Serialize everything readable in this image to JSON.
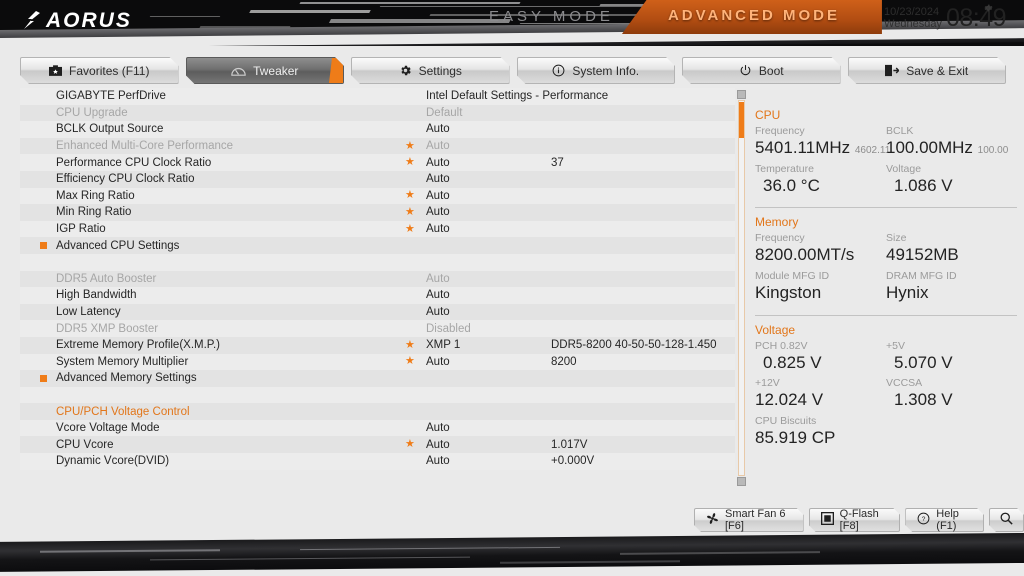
{
  "brand": {
    "logo_text": "AORUS"
  },
  "header": {
    "easy_mode": "EASY MODE",
    "advanced_mode": "ADVANCED MODE",
    "date": "10/23/2024",
    "weekday": "Wednesday",
    "time": "08:49",
    "gear_icon": "gear-icon"
  },
  "tabs": [
    {
      "label": "Favorites (F11)",
      "icon": "star-box-icon",
      "active": false
    },
    {
      "label": "Tweaker",
      "icon": "gauge-icon",
      "active": true
    },
    {
      "label": "Settings",
      "icon": "gear-icon",
      "active": false
    },
    {
      "label": "System Info.",
      "icon": "info-icon",
      "active": false
    },
    {
      "label": "Boot",
      "icon": "power-icon",
      "active": false
    },
    {
      "label": "Save & Exit",
      "icon": "exit-icon",
      "active": false
    }
  ],
  "settings_rows": [
    {
      "label": "GIGABYTE PerfDrive",
      "value": "Intel Default Settings - Performance",
      "extra": "",
      "star": false,
      "dim": false,
      "bullet": false
    },
    {
      "label": "CPU Upgrade",
      "value": "Default",
      "extra": "",
      "star": false,
      "dim": true,
      "bullet": false
    },
    {
      "label": "BCLK Output Source",
      "value": "Auto",
      "extra": "",
      "star": false,
      "dim": false,
      "bullet": false
    },
    {
      "label": "Enhanced Multi-Core Performance",
      "value": "Auto",
      "extra": "",
      "star": true,
      "dim": true,
      "bullet": false
    },
    {
      "label": "Performance CPU Clock Ratio",
      "value": "Auto",
      "extra": "37",
      "star": true,
      "dim": false,
      "bullet": false
    },
    {
      "label": "Efficiency CPU Clock Ratio",
      "value": "Auto",
      "extra": "",
      "star": false,
      "dim": false,
      "bullet": false
    },
    {
      "label": "Max Ring Ratio",
      "value": "Auto",
      "extra": "",
      "star": true,
      "dim": false,
      "bullet": false
    },
    {
      "label": "Min Ring Ratio",
      "value": "Auto",
      "extra": "",
      "star": true,
      "dim": false,
      "bullet": false
    },
    {
      "label": "IGP Ratio",
      "value": "Auto",
      "extra": "",
      "star": true,
      "dim": false,
      "bullet": false
    },
    {
      "label": "Advanced CPU Settings",
      "value": "",
      "extra": "",
      "star": false,
      "dim": false,
      "bullet": true
    },
    {
      "label": "",
      "value": "",
      "extra": "",
      "star": false,
      "dim": false,
      "bullet": false
    },
    {
      "label": "DDR5 Auto Booster",
      "value": "Auto",
      "extra": "",
      "star": false,
      "dim": true,
      "bullet": false
    },
    {
      "label": "High Bandwidth",
      "value": "Auto",
      "extra": "",
      "star": false,
      "dim": false,
      "bullet": false
    },
    {
      "label": "Low Latency",
      "value": "Auto",
      "extra": "",
      "star": false,
      "dim": false,
      "bullet": false
    },
    {
      "label": "DDR5 XMP Booster",
      "value": "Disabled",
      "extra": "",
      "star": false,
      "dim": true,
      "bullet": false
    },
    {
      "label": "Extreme Memory Profile(X.M.P.)",
      "value": "XMP 1",
      "extra": "DDR5-8200 40-50-50-128-1.450",
      "star": true,
      "dim": false,
      "bullet": false
    },
    {
      "label": "System Memory Multiplier",
      "value": "Auto",
      "extra": "8200",
      "star": true,
      "dim": false,
      "bullet": false
    },
    {
      "label": "Advanced Memory Settings",
      "value": "",
      "extra": "",
      "star": false,
      "dim": false,
      "bullet": true
    },
    {
      "label": "",
      "value": "",
      "extra": "",
      "star": false,
      "dim": false,
      "bullet": false
    },
    {
      "label": "CPU/PCH Voltage Control",
      "value": "",
      "extra": "",
      "star": false,
      "dim": false,
      "bullet": false,
      "section": true
    },
    {
      "label": "Vcore Voltage Mode",
      "value": "Auto",
      "extra": "",
      "star": false,
      "dim": false,
      "bullet": false
    },
    {
      "label": "CPU Vcore",
      "value": "Auto",
      "extra": "1.017V",
      "star": true,
      "dim": false,
      "bullet": false
    },
    {
      "label": "Dynamic Vcore(DVID)",
      "value": "Auto",
      "extra": "+0.000V",
      "star": false,
      "dim": false,
      "bullet": false
    }
  ],
  "sidebar": {
    "cpu": {
      "title": "CPU",
      "frequency_label": "Frequency",
      "frequency_value": "5401.11MHz",
      "frequency_sub": "4602.11",
      "bclk_label": "BCLK",
      "bclk_value": "100.00MHz",
      "bclk_sub": "100.00",
      "temperature_label": "Temperature",
      "temperature_value": "36.0 °C",
      "voltage_label": "Voltage",
      "voltage_value": "1.086 V"
    },
    "memory": {
      "title": "Memory",
      "frequency_label": "Frequency",
      "frequency_value": "8200.00MT/s",
      "size_label": "Size",
      "size_value": "49152MB",
      "module_mfg_label": "Module MFG ID",
      "module_mfg_value": "Kingston",
      "dram_mfg_label": "DRAM MFG ID",
      "dram_mfg_value": "Hynix"
    },
    "voltage": {
      "title": "Voltage",
      "pch_label": "PCH 0.82V",
      "pch_value": "0.825 V",
      "p5v_label": "+5V",
      "p5v_value": "5.070 V",
      "p12v_label": "+12V",
      "p12v_value": "12.024 V",
      "vccsa_label": "VCCSA",
      "vccsa_value": "1.308 V",
      "biscuits_label": "CPU Biscuits",
      "biscuits_value": "85.919 CP"
    }
  },
  "bottom_bar": [
    {
      "label": "Smart Fan 6 [F6]",
      "icon": "fan-icon"
    },
    {
      "label": "Q-Flash [F8]",
      "icon": "chip-icon"
    },
    {
      "label": "Help (F1)",
      "icon": "question-icon"
    }
  ],
  "search_icon": "search-icon",
  "colors": {
    "accent": "#ef7c18",
    "accent_dark": "#b24d12",
    "text": "#262626",
    "dim_text": "#a6a6a6"
  }
}
